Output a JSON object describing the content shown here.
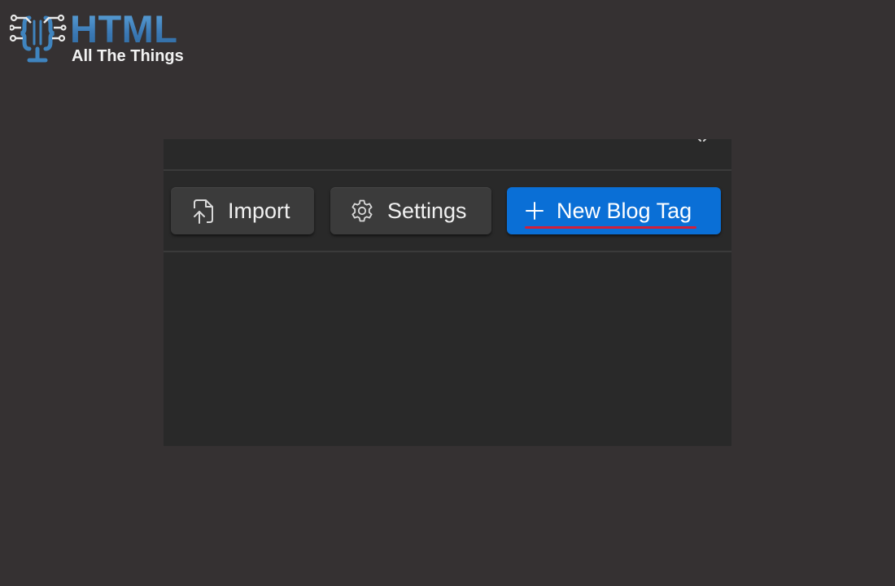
{
  "logo": {
    "title": "HTML",
    "subtitle": "All The Things",
    "mark_icon": "microphone-circuit-icon",
    "title_color": "#3f84bf"
  },
  "dialog": {
    "close_icon": "close-icon",
    "toolbar": {
      "import": {
        "label": "Import",
        "icon": "file-import-icon"
      },
      "settings": {
        "label": "Settings",
        "icon": "gear-icon"
      },
      "new_blog_tag": {
        "label": "New Blog Tag",
        "icon": "plus-icon",
        "accent": "#0a6fd6",
        "underline_color": "#d21f3a"
      }
    }
  },
  "colors": {
    "page_background": "#353132",
    "panel_background": "#292929",
    "secondary_button": "#3b3b3b"
  }
}
